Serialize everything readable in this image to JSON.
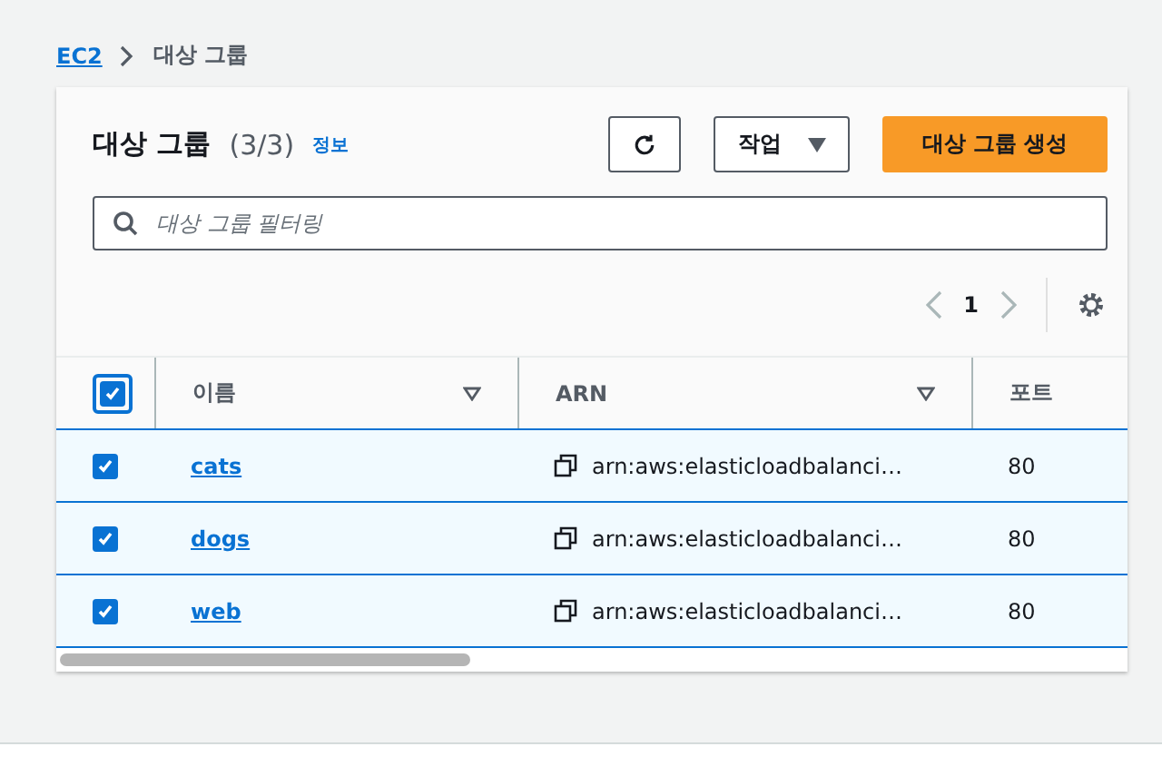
{
  "breadcrumb": [
    {
      "label": "EC2",
      "kind": "link"
    },
    {
      "label": "대상 그룹",
      "kind": "current"
    }
  ],
  "panel": {
    "title": "대상 그룹",
    "count": "(3/3)",
    "info": "정보",
    "actions_button": "작업",
    "create_button": "대상 그룹 생성"
  },
  "search": {
    "placeholder": "대상 그룹 필터링"
  },
  "pagination": {
    "page": "1"
  },
  "table": {
    "select_all": {
      "checked": true
    },
    "columns": [
      "이름",
      "ARN",
      "포트"
    ],
    "rows": [
      {
        "name": "cats",
        "arn": "arn:aws:elasticloadbalanci…",
        "port": "80",
        "selected": true
      },
      {
        "name": "dogs",
        "arn": "arn:aws:elasticloadbalanci…",
        "port": "80",
        "selected": true
      },
      {
        "name": "web",
        "arn": "arn:aws:elasticloadbalanci…",
        "port": "80",
        "selected": true
      }
    ]
  }
}
